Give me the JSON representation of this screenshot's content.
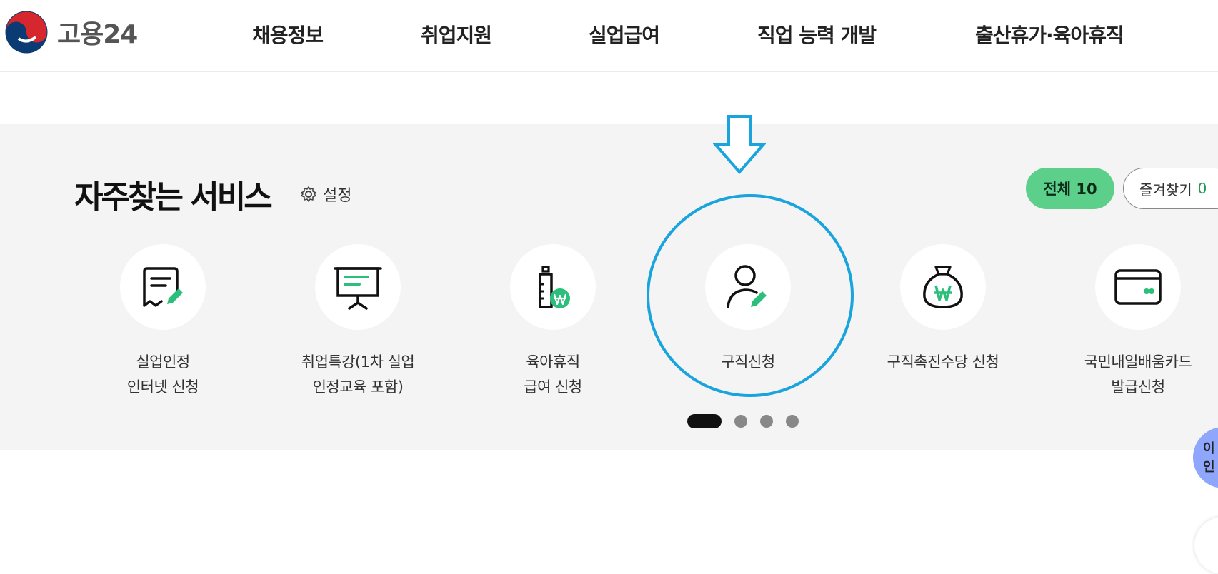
{
  "header": {
    "logo_text": "고용24",
    "nav": [
      "채용정보",
      "취업지원",
      "실업급여",
      "직업 능력 개발",
      "출산휴가·육아휴직"
    ]
  },
  "section": {
    "title": "자주찾는 서비스",
    "settings_label": "설정",
    "filter_all": "전체 10",
    "filter_fav_label": "즐겨찾기",
    "filter_fav_count": "0"
  },
  "services": [
    {
      "line1": "실업인정",
      "line2": "인터넷 신청",
      "icon": "certificate-edit-icon"
    },
    {
      "line1": "취업특강(1차 실업",
      "line2": "인정교육 포함)",
      "icon": "presentation-board-icon"
    },
    {
      "line1": "육아휴직",
      "line2": "급여 신청",
      "icon": "baby-bottle-won-icon"
    },
    {
      "line1": "구직신청",
      "line2": "",
      "icon": "person-edit-icon"
    },
    {
      "line1": "구직촉진수당 신청",
      "line2": "",
      "icon": "money-bag-won-icon"
    },
    {
      "line1": "국민내일배움카드",
      "line2": "발급신청",
      "icon": "card-icon"
    }
  ],
  "carousel": {
    "pages": 4,
    "active": 1
  },
  "side": {
    "badge_line1": "이",
    "badge_line2": "인"
  },
  "colors": {
    "accent_green": "#5ccf8b",
    "icon_green": "#2bbf7b",
    "highlight_blue": "#19a4de",
    "background_gray": "#f4f4f4"
  }
}
